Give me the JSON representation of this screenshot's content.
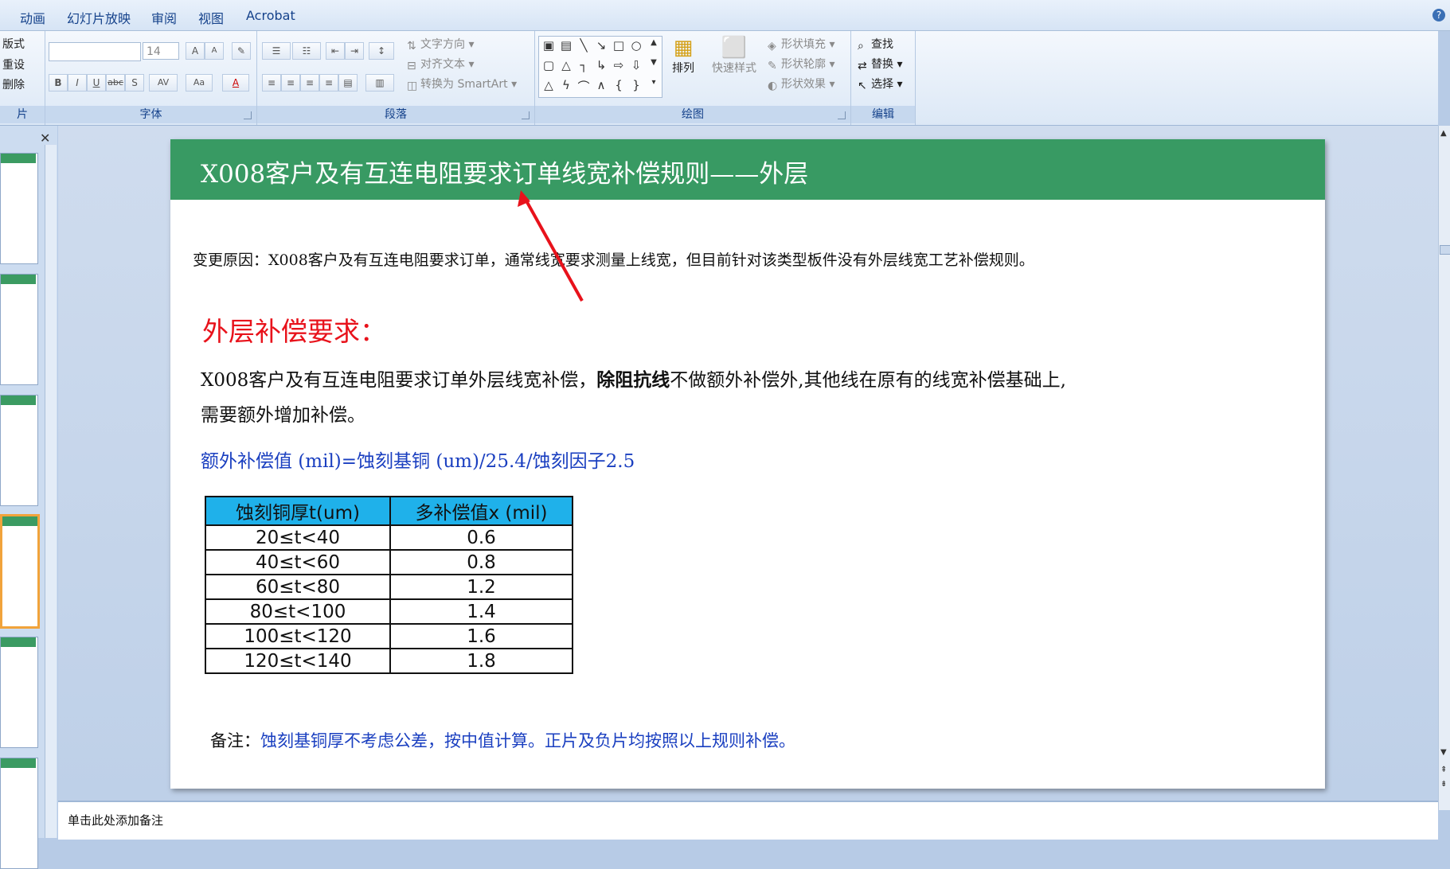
{
  "menu": [
    "动画",
    "幻灯片放映",
    "审阅",
    "视图",
    "Acrobat"
  ],
  "ribbon": {
    "slides_group": {
      "layout": "版式",
      "reset": "重设",
      "delete": "删除",
      "label": "片"
    },
    "font_group": {
      "font_name": "",
      "font_size": "14",
      "label": "字体",
      "bold": "B",
      "italic": "I",
      "underline": "U",
      "strike": "abc",
      "shadow": "S",
      "spacing": "AV",
      "case": "Aa",
      "color": "A",
      "grow": "A",
      "shrink": "A"
    },
    "paragraph_group": {
      "text_direction": "文字方向",
      "align_text": "对齐文本",
      "smartart": "转换为 SmartArt",
      "label": "段落"
    },
    "drawing_group": {
      "arrange": "排列",
      "quick_styles": "快速样式",
      "fill": "形状填充",
      "outline": "形状轮廓",
      "effects": "形状效果",
      "label": "绘图"
    },
    "editing_group": {
      "find": "查找",
      "replace": "替换",
      "select": "选择",
      "label": "编辑"
    }
  },
  "slide": {
    "title": "X008客户及有互连电阻要求订单线宽补偿规则——外层",
    "reason": "变更原因：X008客户及有互连电阻要求订单，通常线宽要求测量上线宽，但目前针对该类型板件没有外层线宽工艺补偿规则。",
    "heading": "外层补偿要求：",
    "line1_a": "X008客户及有互连电阻要求订单外层线宽补偿，",
    "line1_bold": "除阻抗线",
    "line1_b": "不做额外补偿外,其他线在原有的线宽补偿基础上,",
    "line2": "需要额外增加补偿。",
    "formula": "额外补偿值 (mil)=蚀刻基铜 (um)/25.4/蚀刻因子2.5",
    "table": {
      "headers": [
        "蚀刻铜厚t(um)",
        "多补偿值x (mil)"
      ],
      "rows": [
        [
          "20≤t<40",
          "0.6"
        ],
        [
          "40≤t<60",
          "0.8"
        ],
        [
          "60≤t<80",
          "1.2"
        ],
        [
          "80≤t<100",
          "1.4"
        ],
        [
          "100≤t<120",
          "1.6"
        ],
        [
          "120≤t<140",
          "1.8"
        ]
      ]
    },
    "note_label": "备注：",
    "note_text": "蚀刻基铜厚不考虑公差，按中值计算。正片及负片均按照以上规则补偿。",
    "accent_colors": {
      "title_bar": "#389a63",
      "heading": "#e8121b",
      "formula": "#1a3fc0",
      "table_header": "#1fb1ea",
      "arrow": "#e8121b"
    }
  },
  "notes": {
    "placeholder": "单击此处添加备注"
  }
}
